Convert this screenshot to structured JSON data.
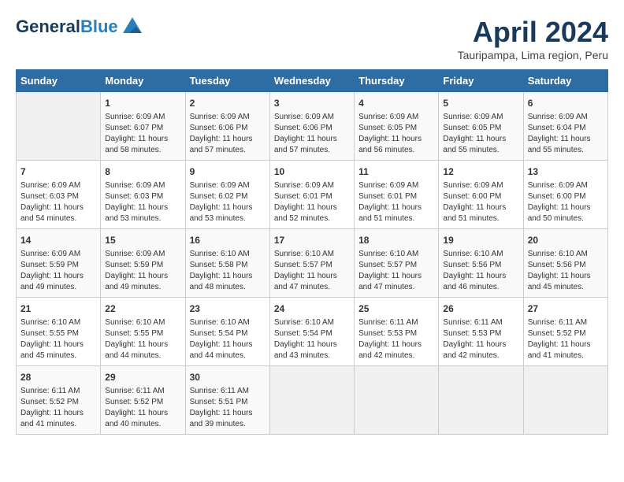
{
  "header": {
    "logo_line1": "General",
    "logo_line2": "Blue",
    "month_year": "April 2024",
    "location": "Tauripampa, Lima region, Peru"
  },
  "days_of_week": [
    "Sunday",
    "Monday",
    "Tuesday",
    "Wednesday",
    "Thursday",
    "Friday",
    "Saturday"
  ],
  "weeks": [
    [
      {
        "day": "",
        "info": ""
      },
      {
        "day": "1",
        "info": "Sunrise: 6:09 AM\nSunset: 6:07 PM\nDaylight: 11 hours\nand 58 minutes."
      },
      {
        "day": "2",
        "info": "Sunrise: 6:09 AM\nSunset: 6:06 PM\nDaylight: 11 hours\nand 57 minutes."
      },
      {
        "day": "3",
        "info": "Sunrise: 6:09 AM\nSunset: 6:06 PM\nDaylight: 11 hours\nand 57 minutes."
      },
      {
        "day": "4",
        "info": "Sunrise: 6:09 AM\nSunset: 6:05 PM\nDaylight: 11 hours\nand 56 minutes."
      },
      {
        "day": "5",
        "info": "Sunrise: 6:09 AM\nSunset: 6:05 PM\nDaylight: 11 hours\nand 55 minutes."
      },
      {
        "day": "6",
        "info": "Sunrise: 6:09 AM\nSunset: 6:04 PM\nDaylight: 11 hours\nand 55 minutes."
      }
    ],
    [
      {
        "day": "7",
        "info": "Sunrise: 6:09 AM\nSunset: 6:03 PM\nDaylight: 11 hours\nand 54 minutes."
      },
      {
        "day": "8",
        "info": "Sunrise: 6:09 AM\nSunset: 6:03 PM\nDaylight: 11 hours\nand 53 minutes."
      },
      {
        "day": "9",
        "info": "Sunrise: 6:09 AM\nSunset: 6:02 PM\nDaylight: 11 hours\nand 53 minutes."
      },
      {
        "day": "10",
        "info": "Sunrise: 6:09 AM\nSunset: 6:01 PM\nDaylight: 11 hours\nand 52 minutes."
      },
      {
        "day": "11",
        "info": "Sunrise: 6:09 AM\nSunset: 6:01 PM\nDaylight: 11 hours\nand 51 minutes."
      },
      {
        "day": "12",
        "info": "Sunrise: 6:09 AM\nSunset: 6:00 PM\nDaylight: 11 hours\nand 51 minutes."
      },
      {
        "day": "13",
        "info": "Sunrise: 6:09 AM\nSunset: 6:00 PM\nDaylight: 11 hours\nand 50 minutes."
      }
    ],
    [
      {
        "day": "14",
        "info": "Sunrise: 6:09 AM\nSunset: 5:59 PM\nDaylight: 11 hours\nand 49 minutes."
      },
      {
        "day": "15",
        "info": "Sunrise: 6:09 AM\nSunset: 5:59 PM\nDaylight: 11 hours\nand 49 minutes."
      },
      {
        "day": "16",
        "info": "Sunrise: 6:10 AM\nSunset: 5:58 PM\nDaylight: 11 hours\nand 48 minutes."
      },
      {
        "day": "17",
        "info": "Sunrise: 6:10 AM\nSunset: 5:57 PM\nDaylight: 11 hours\nand 47 minutes."
      },
      {
        "day": "18",
        "info": "Sunrise: 6:10 AM\nSunset: 5:57 PM\nDaylight: 11 hours\nand 47 minutes."
      },
      {
        "day": "19",
        "info": "Sunrise: 6:10 AM\nSunset: 5:56 PM\nDaylight: 11 hours\nand 46 minutes."
      },
      {
        "day": "20",
        "info": "Sunrise: 6:10 AM\nSunset: 5:56 PM\nDaylight: 11 hours\nand 45 minutes."
      }
    ],
    [
      {
        "day": "21",
        "info": "Sunrise: 6:10 AM\nSunset: 5:55 PM\nDaylight: 11 hours\nand 45 minutes."
      },
      {
        "day": "22",
        "info": "Sunrise: 6:10 AM\nSunset: 5:55 PM\nDaylight: 11 hours\nand 44 minutes."
      },
      {
        "day": "23",
        "info": "Sunrise: 6:10 AM\nSunset: 5:54 PM\nDaylight: 11 hours\nand 44 minutes."
      },
      {
        "day": "24",
        "info": "Sunrise: 6:10 AM\nSunset: 5:54 PM\nDaylight: 11 hours\nand 43 minutes."
      },
      {
        "day": "25",
        "info": "Sunrise: 6:11 AM\nSunset: 5:53 PM\nDaylight: 11 hours\nand 42 minutes."
      },
      {
        "day": "26",
        "info": "Sunrise: 6:11 AM\nSunset: 5:53 PM\nDaylight: 11 hours\nand 42 minutes."
      },
      {
        "day": "27",
        "info": "Sunrise: 6:11 AM\nSunset: 5:52 PM\nDaylight: 11 hours\nand 41 minutes."
      }
    ],
    [
      {
        "day": "28",
        "info": "Sunrise: 6:11 AM\nSunset: 5:52 PM\nDaylight: 11 hours\nand 41 minutes."
      },
      {
        "day": "29",
        "info": "Sunrise: 6:11 AM\nSunset: 5:52 PM\nDaylight: 11 hours\nand 40 minutes."
      },
      {
        "day": "30",
        "info": "Sunrise: 6:11 AM\nSunset: 5:51 PM\nDaylight: 11 hours\nand 39 minutes."
      },
      {
        "day": "",
        "info": ""
      },
      {
        "day": "",
        "info": ""
      },
      {
        "day": "",
        "info": ""
      },
      {
        "day": "",
        "info": ""
      }
    ]
  ]
}
